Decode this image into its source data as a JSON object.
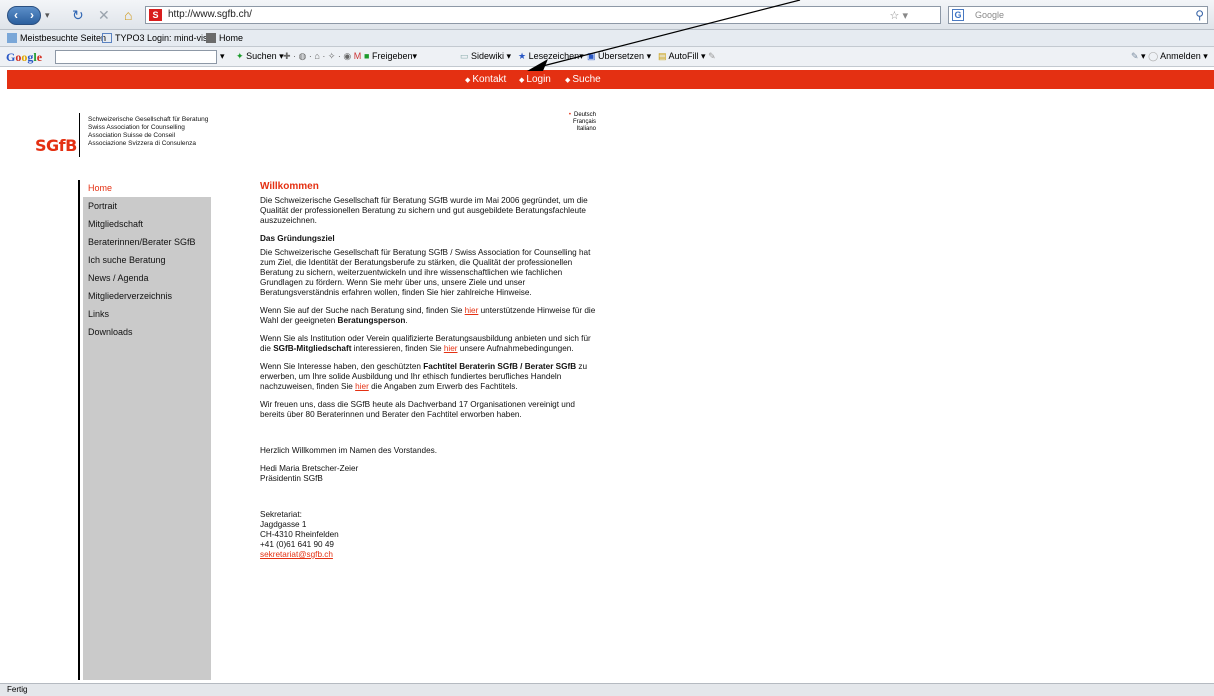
{
  "browser": {
    "url": "http://www.sgfb.ch/",
    "favicon_letter": "S",
    "search_placeholder": "Google",
    "bookmarks": [
      "Meistbesuchte Seiten",
      "TYPO3 Login: mind-vis...",
      "Home"
    ],
    "google_toolbar": {
      "logo": "Google",
      "items": [
        "Suchen",
        "Freigeben",
        "Sidewiki",
        "Lesezeichen",
        "Übersetzen",
        "AutoFill"
      ],
      "signin": "Anmelden"
    },
    "status": "Fertig"
  },
  "site": {
    "top_links": [
      "Kontakt",
      "Login",
      "Suche"
    ],
    "logo": "SGfB",
    "association_names": [
      "Schweizerische Gesellschaft für Beratung",
      "Swiss Association for Counselling",
      "Association Suisse de Conseil",
      "Associazione Svizzera di Consulenza"
    ],
    "languages": [
      "Deutsch",
      "Français",
      "Italiano"
    ],
    "nav": [
      "Home",
      "Portrait",
      "Mitgliedschaft",
      "Beraterinnen/Berater SGfB",
      "Ich suche Beratung",
      "News / Agenda",
      "Mitgliederverzeichnis",
      "Links",
      "Downloads"
    ]
  },
  "content": {
    "title": "Willkommen",
    "intro": "Die Schweizerische Gesellschaft für Beratung SGfB wurde im Mai 2006 gegründet, um die Qualität der professionellen Beratung zu sichern und gut ausgebildete Beratungsfachleute auszuzeichnen.",
    "subtitle": "Das Gründungsziel",
    "goal": "Die Schweizerische Gesellschaft für Beratung SGfB / Swiss Association for Counselling hat zum Ziel, die Identität der Beratungsberufe zu stärken, die Qualität der professionellen Beratung zu sichern, weiterzuentwickeln und ihre wissenschaftlichen wie fachlichen Grundlagen zu fördern. Wenn Sie mehr über uns, unsere Ziele und unser Beratungsverständnis erfahren wollen, finden Sie hier zahlreiche Hinweise.",
    "p1_a": "Wenn Sie auf der Suche nach Beratung sind, finden Sie ",
    "p1_link": "hier",
    "p1_b": " unterstützende Hinweise für die Wahl der geeigneten ",
    "p1_bold": "Beratungsperson",
    "p1_c": ".",
    "p2_a": "Wenn Sie als Institution oder Verein qualifizierte Beratungsausbildung anbieten und sich für die ",
    "p2_bold": "SGfB-Mitgliedschaft",
    "p2_b": " interessieren, finden Sie ",
    "p2_link": "hier",
    "p2_c": " unsere Aufnahmebedingungen.",
    "p3_a": "Wenn Sie Interesse haben, den geschützten ",
    "p3_bold": "Fachtitel Beraterin SGfB / Berater SGfB",
    "p3_b": " zu erwerben, um Ihre solide Ausbildung und Ihr ethisch fundiertes berufliches Handeln nachzuweisen, finden Sie ",
    "p3_link": "hier",
    "p3_c": " die Angaben zum Erwerb des Fachtitels.",
    "p4": "Wir freuen uns, dass die SGfB heute als Dachverband 17 Organisationen vereinigt und bereits über 80 Beraterinnen und Berater den Fachtitel erworben haben.",
    "greeting": "Herzlich Willkommen im Namen des Vorstandes.",
    "signer_name": "Hedi Maria Bretscher-Zeier",
    "signer_role": "Präsidentin SGfB",
    "address": [
      "Sekretariat:",
      "Jagdgasse 1",
      "CH-4310 Rheinfelden",
      "+41 (0)61 641 90 49"
    ],
    "email": "sekretariat@sgfb.ch"
  }
}
